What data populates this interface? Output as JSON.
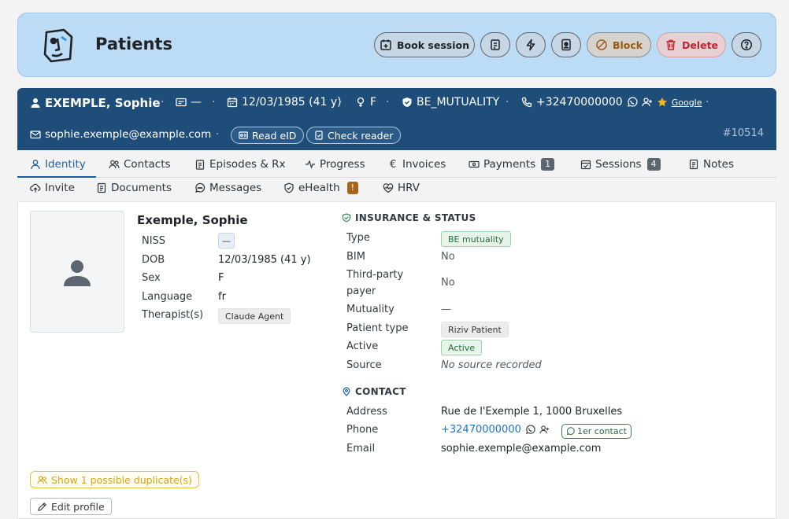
{
  "header": {
    "title": "Patients",
    "buttons": {
      "book": "Book session",
      "block": "Block",
      "delete": "Delete"
    }
  },
  "banner": {
    "name": "EXEMPLE, Sophie",
    "card": "—",
    "dob": "12/03/1985 (41 y)",
    "sex": "F",
    "insurance": "BE_MUTUALITY",
    "phone": "+32470000000",
    "google": "Google",
    "email": "sophie.exemple@example.com",
    "read_eid": "Read eID",
    "check_reader": "Check reader",
    "patient_id": "#10514"
  },
  "tabs": [
    {
      "label": "Identity"
    },
    {
      "label": "Contacts"
    },
    {
      "label": "Episodes & Rx"
    },
    {
      "label": "Progress"
    },
    {
      "label": "Invoices"
    },
    {
      "label": "Payments",
      "count": "1"
    },
    {
      "label": "Sessions",
      "count": "4"
    },
    {
      "label": "Notes"
    },
    {
      "label": "Invite"
    },
    {
      "label": "Documents"
    },
    {
      "label": "Messages"
    },
    {
      "label": "eHealth",
      "badge": "!"
    },
    {
      "label": "HRV"
    }
  ],
  "identity": {
    "full_name": "Exemple, Sophie",
    "niss_label": "NISS",
    "niss_value": "—",
    "dob_label": "DOB",
    "dob_value": "12/03/1985 (41 y)",
    "sex_label": "Sex",
    "sex_value": "F",
    "language_label": "Language",
    "language_value": "fr",
    "therapist_label": "Therapist(s)",
    "therapist_value": "Claude Agent"
  },
  "insurance": {
    "title": "INSURANCE & STATUS",
    "type_label": "Type",
    "type_value": "BE mutuality",
    "bim_label": "BIM",
    "bim_value": "No",
    "third_party_label_1": "Third-party",
    "third_party_label_2": "payer",
    "third_party_value": "No",
    "mutuality_label": "Mutuality",
    "mutuality_value": "—",
    "patient_type_label": "Patient type",
    "patient_type_value": "Riziv Patient",
    "active_label": "Active",
    "active_value": "Active",
    "source_label": "Source",
    "source_value": "No source recorded"
  },
  "contact": {
    "title": "CONTACT",
    "address_label": "Address",
    "address_value": "Rue de l'Exemple 1, 1000 Bruxelles",
    "phone_label": "Phone",
    "phone_value": "+32470000000",
    "first_contact": "1er contact",
    "email_label": "Email",
    "email_value": "sophie.exemple@example.com"
  },
  "actions": {
    "duplicates": "Show 1 possible duplicate(s)",
    "edit_profile": "Edit profile"
  },
  "colors": {
    "header_bg": "#bcdcf6",
    "banner_bg": "#1e4d7a",
    "active_tab": "#1f5e9c",
    "link": "#1f6fd0",
    "warning": "#d4a512"
  }
}
